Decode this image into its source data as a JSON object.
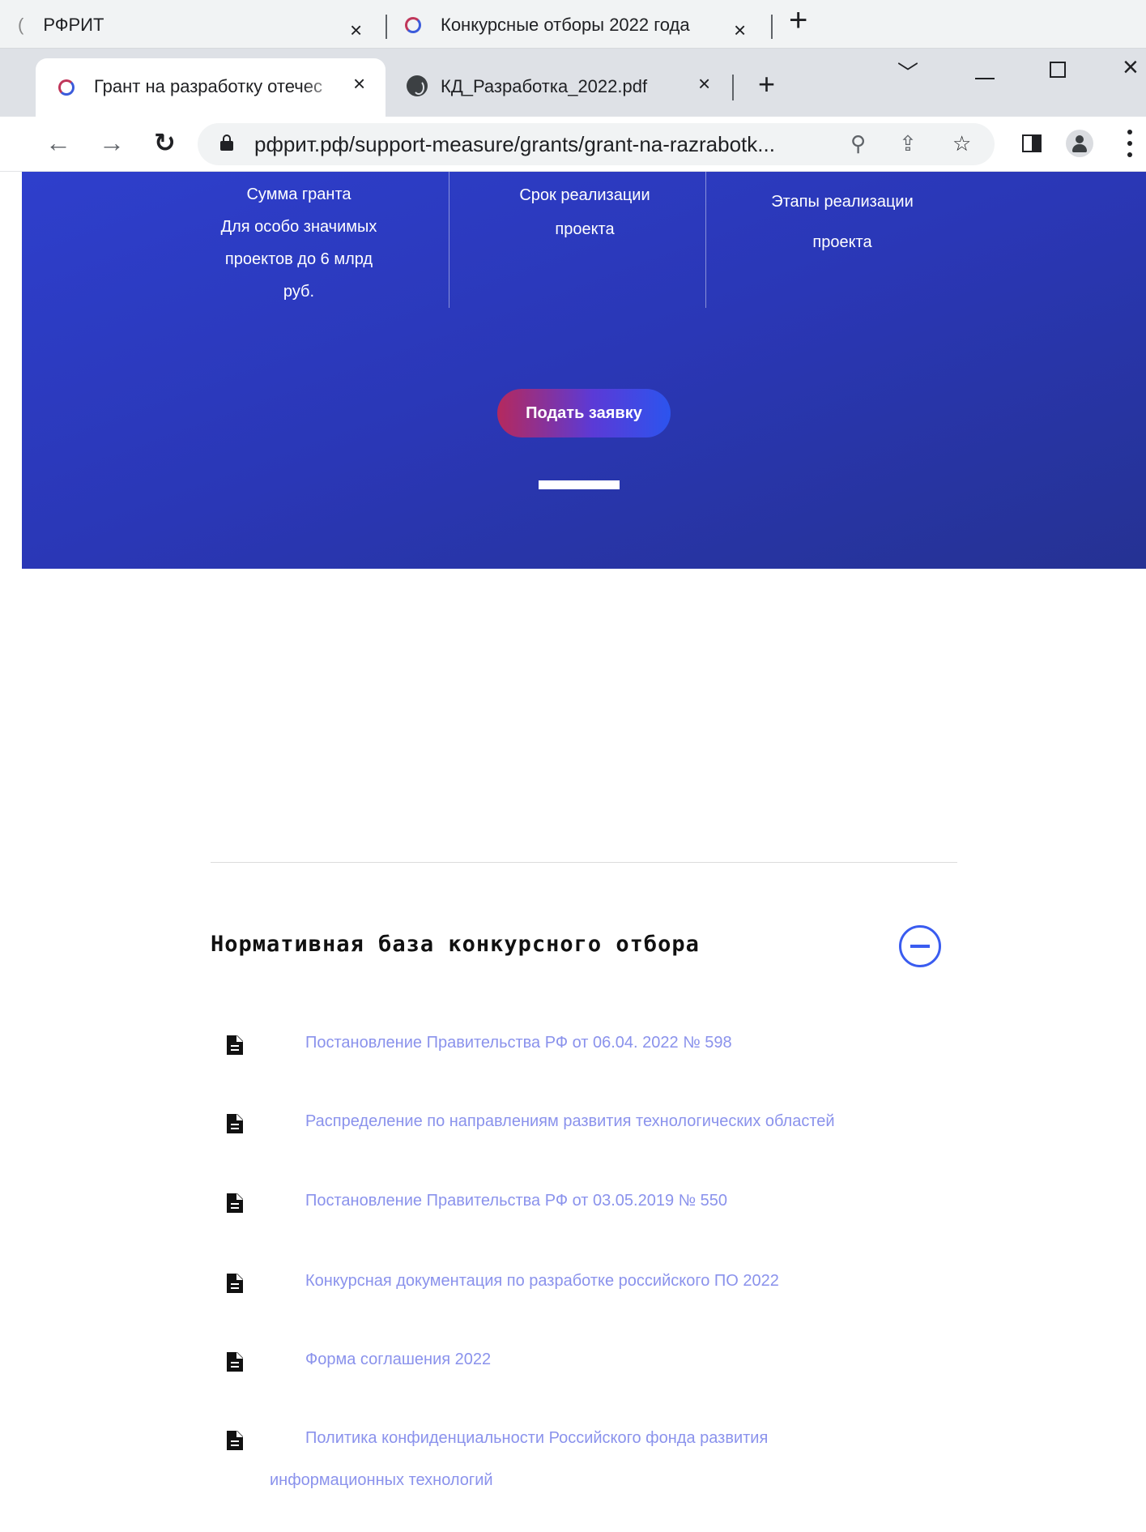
{
  "browser": {
    "window1": {
      "tabs": [
        {
          "title": "РФРИТ"
        },
        {
          "title": "Конкурсные отборы 2022 года"
        }
      ]
    },
    "window2": {
      "tabs": [
        {
          "title": "Грант на разработку отечес"
        },
        {
          "title": "КД_Разработка_2022.pdf"
        }
      ]
    },
    "address_bar": {
      "url": "рфрит.рф/support-measure/grants/grant-na-razrabotk..."
    }
  },
  "hero": {
    "stats": [
      {
        "lines": [
          "Сумма гранта",
          "Для особо значимых",
          "проектов до 6 млрд",
          "руб."
        ]
      },
      {
        "lines": [
          "Срок реализации",
          "проекта"
        ]
      },
      {
        "lines": [
          "Этапы реализации",
          "проекта"
        ]
      }
    ],
    "apply_button": "Подать заявку"
  },
  "normative": {
    "title": "Нормативная база конкурсного отбора",
    "documents": [
      {
        "label": "Постановление Правительства РФ от 06.04. 2022 № 598"
      },
      {
        "label": "Распределение по направлениям развития технологических областей"
      },
      {
        "label": "Постановление Правительства РФ от 03.05.2019 № 550"
      },
      {
        "label": "Конкурсная документация по разработке российского ПО 2022"
      },
      {
        "label": "Форма соглашения 2022"
      },
      {
        "label_line1": "Политика конфиденциальности Российского фонда развития",
        "label_line2": "информационных технологий"
      }
    ]
  },
  "colors": {
    "hero_bg": "#2a37b6",
    "link": "#8a92ec",
    "accent": "#3a5cf0"
  }
}
